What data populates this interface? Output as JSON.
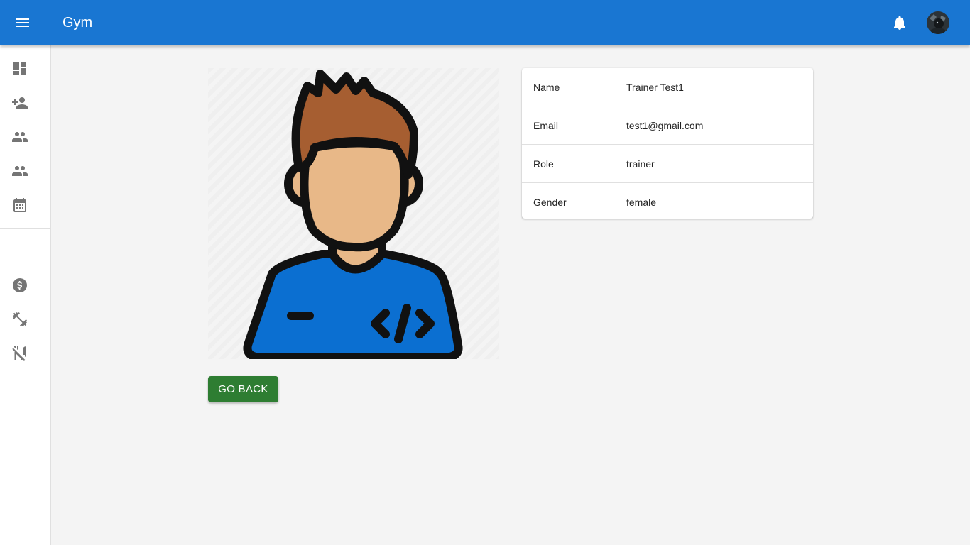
{
  "app": {
    "title": "Gym"
  },
  "header": {
    "menu_icon": "menu-icon",
    "notification_icon": "bell-icon",
    "avatar_icon": "user-avatar"
  },
  "sidebar": {
    "items": [
      {
        "icon": "dashboard-icon"
      },
      {
        "icon": "person-add-icon"
      },
      {
        "icon": "people-icon"
      },
      {
        "icon": "people-icon"
      },
      {
        "icon": "calendar-icon"
      },
      {
        "icon": "dollar-icon"
      },
      {
        "icon": "fitness-center-icon"
      },
      {
        "icon": "no-meals-icon"
      }
    ]
  },
  "profile": {
    "image_icon": "developer-avatar-illustration",
    "details": [
      {
        "label": "Name",
        "value": "Trainer Test1"
      },
      {
        "label": "Email",
        "value": "test1@gmail.com"
      },
      {
        "label": "Role",
        "value": "trainer"
      },
      {
        "label": "Gender",
        "value": "female"
      }
    ]
  },
  "actions": {
    "go_back_label": "GO BACK"
  },
  "colors": {
    "appbar": "#1976d2",
    "go_back_button": "#2e7d32",
    "background": "#f4f4f4",
    "shirt": "#0b6fd1",
    "hair": "#a65e31",
    "skin": "#e8b888"
  }
}
